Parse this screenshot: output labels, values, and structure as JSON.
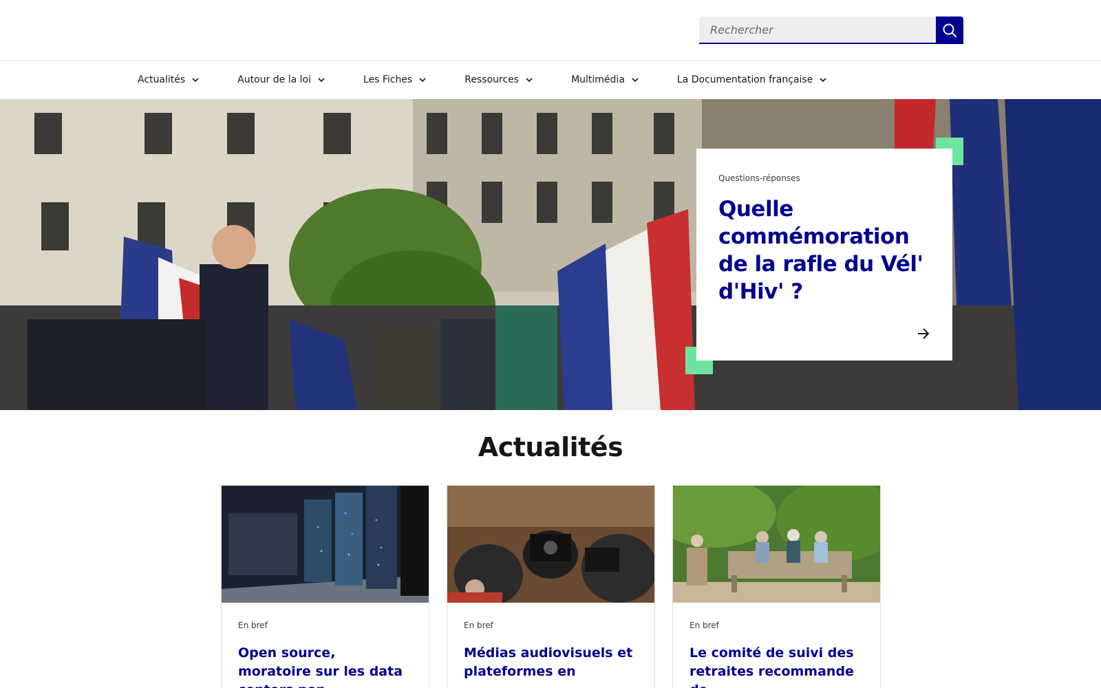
{
  "search": {
    "placeholder": "Rechercher"
  },
  "nav": {
    "items": [
      {
        "label": "Actualités"
      },
      {
        "label": "Autour de la loi"
      },
      {
        "label": "Les Fiches"
      },
      {
        "label": "Ressources"
      },
      {
        "label": "Multimédia"
      },
      {
        "label": "La Documentation française"
      }
    ]
  },
  "hero": {
    "kicker": "Questions-réponses",
    "title": "Quelle commémoration de la rafle du Vél' d'Hiv' ?"
  },
  "news": {
    "heading": "Actualités",
    "cards": [
      {
        "kicker": "En bref",
        "title": "Open source, moratoire sur les data centers non"
      },
      {
        "kicker": "En bref",
        "title": "Médias audiovisuels et plateformes en"
      },
      {
        "kicker": "En bref",
        "title": "Le comité de suivi des retraites recommande de"
      }
    ]
  },
  "colors": {
    "accent": "#000091",
    "corner_green": "#6fe4a0",
    "border": "#dddddd"
  }
}
